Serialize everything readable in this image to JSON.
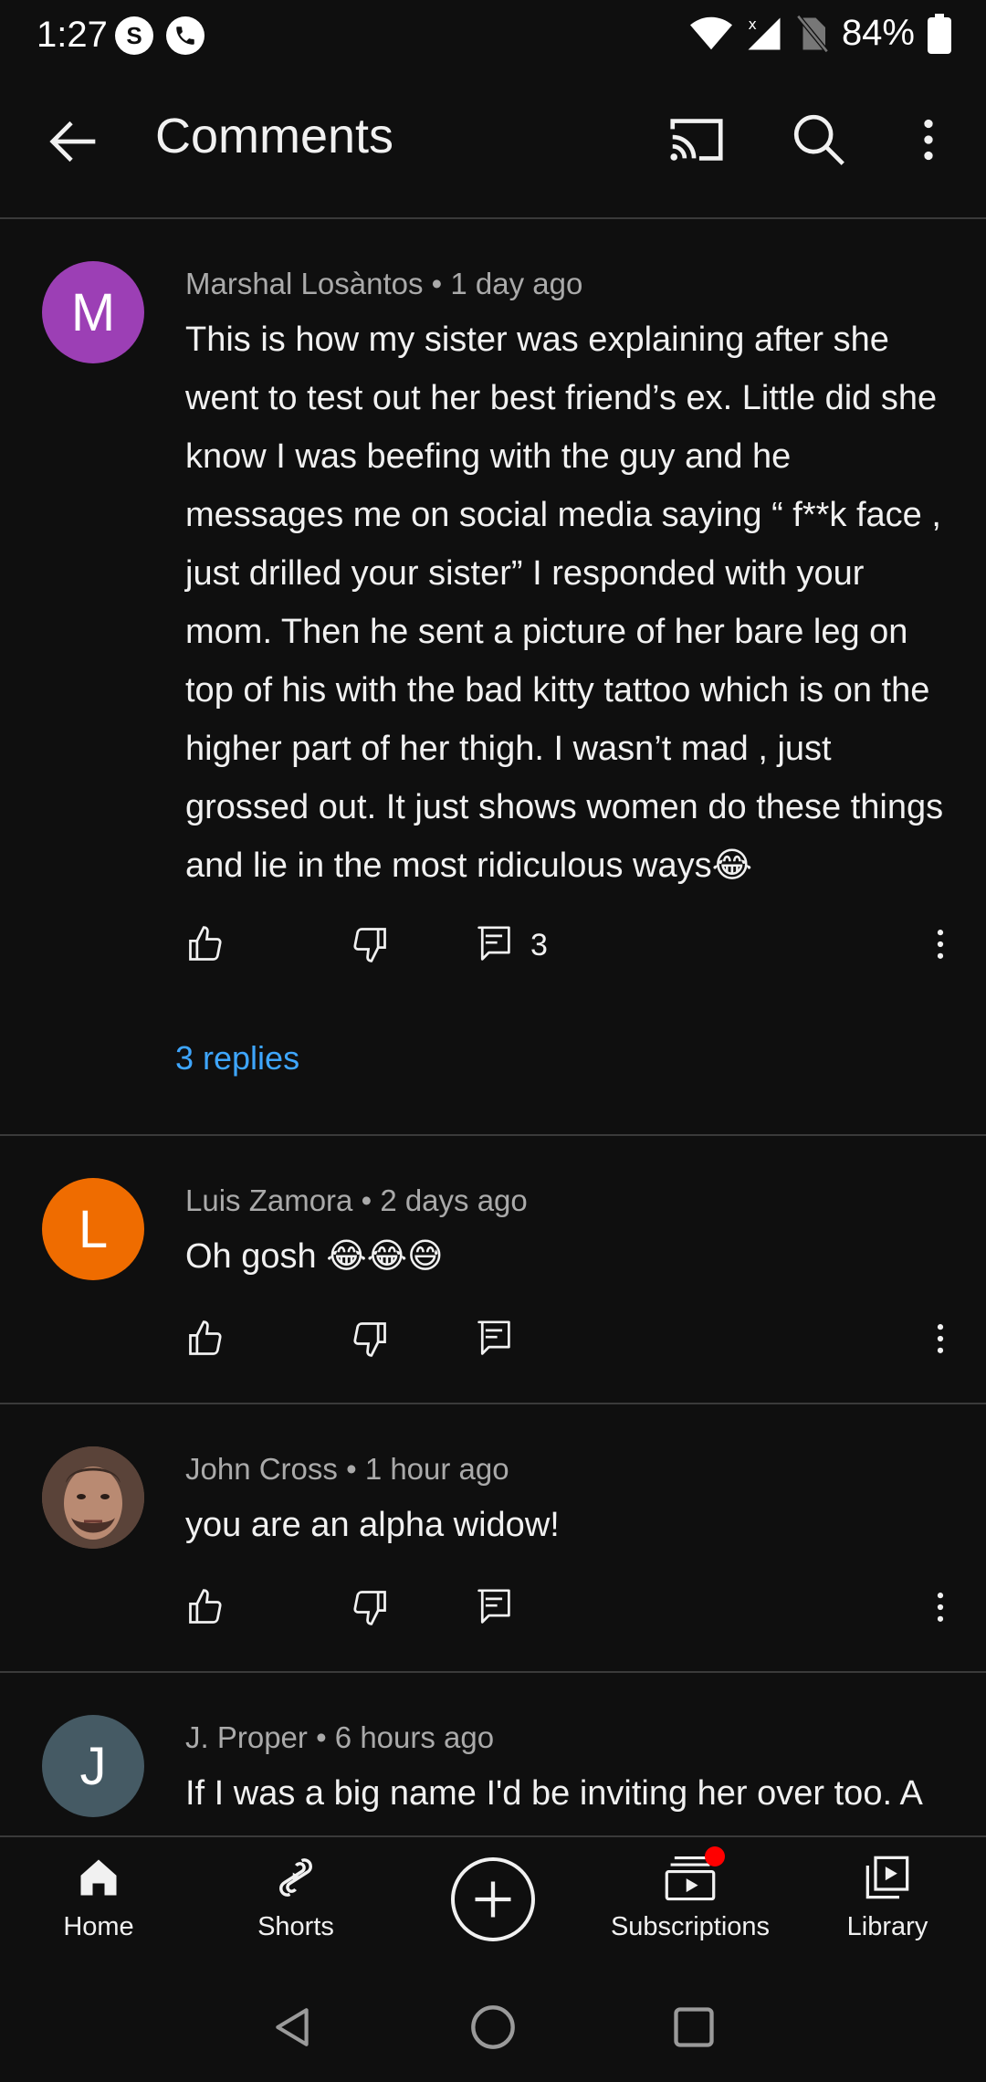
{
  "status_bar": {
    "time": "1:27",
    "battery": "84%"
  },
  "app_bar": {
    "title": "Comments"
  },
  "comments": [
    {
      "avatar_letter": "M",
      "avatar_color": "#9c3fb5",
      "author": "Marshal Losàntos",
      "time": "1 day ago",
      "text": "This is how my sister was explaining after she went to test out her best friend’s ex. Little did she know I was beefing with the guy and he messages me on social media saying “ f**k face , just drilled your sister” I responded with your mom. Then he sent a picture of her bare leg on top of his with the bad kitty tattoo which is on the higher part of her thigh. I wasn’t mad , just grossed out. It just shows women do these things and lie in the most ridiculous ways😂",
      "reply_count": "3",
      "replies_link": "3 replies"
    },
    {
      "avatar_letter": "L",
      "avatar_color": "#ef6c00",
      "author": "Luis Zamora",
      "time": "2 days ago",
      "text": "Oh gosh 😂😂😅"
    },
    {
      "avatar_letter": "",
      "avatar_color": "#6b5448",
      "author": "John Cross",
      "time": "1 hour ago",
      "text": "you are an alpha widow!"
    },
    {
      "avatar_letter": "J",
      "avatar_color": "#455a64",
      "author": "J. Proper",
      "time": "6 hours ago",
      "text": "If I was a big name I'd be inviting her over too. A"
    }
  ],
  "bottom_nav": {
    "home": "Home",
    "shorts": "Shorts",
    "subscriptions": "Subscriptions",
    "library": "Library"
  },
  "colors": {
    "link": "#3ea6ff",
    "background": "#0f0f0f",
    "notification_dot": "#ff0000"
  }
}
